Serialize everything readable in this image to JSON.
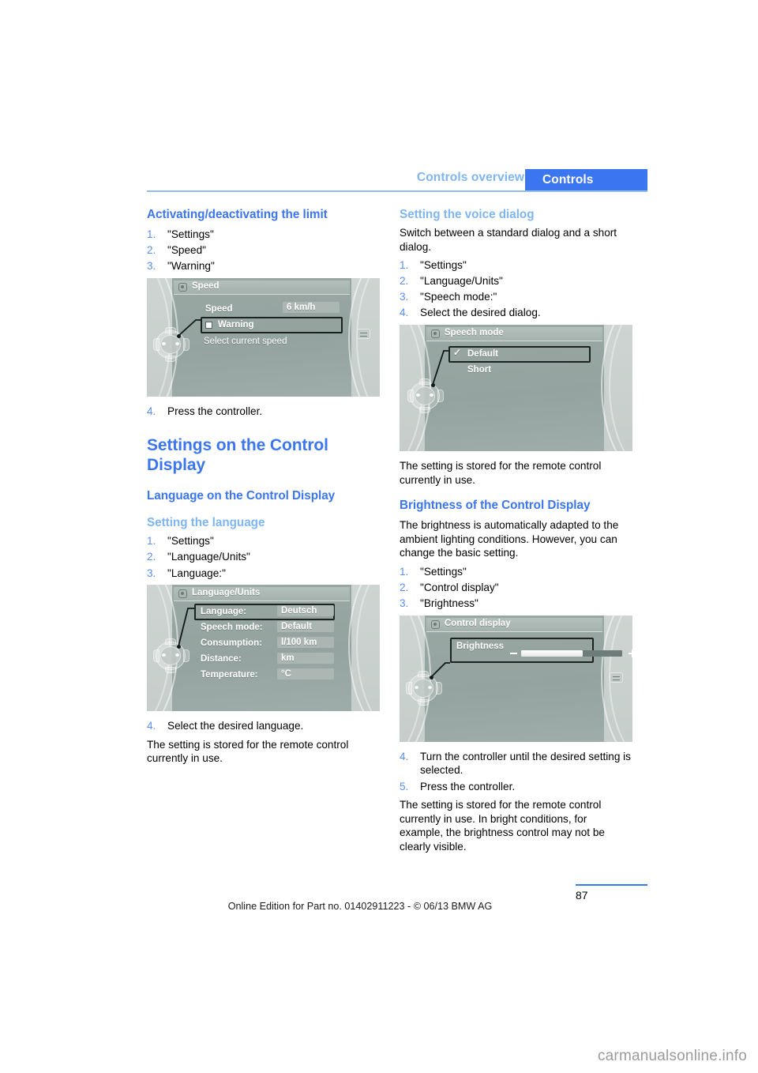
{
  "header": {
    "chapter": "Controls overview",
    "tab": "Controls"
  },
  "left_column": {
    "heading_limit": "Activating/deactivating the limit",
    "limit_steps": [
      "\"Settings\"",
      "\"Speed\"",
      "\"Warning\""
    ],
    "speed_screen": {
      "title": "Speed",
      "row_label": "Speed",
      "row_value": "6 km/h",
      "checkbox_label": "Warning",
      "hint": "Select current speed"
    },
    "step4": "Press the controller.",
    "heading_settings": "Settings on the Control Display",
    "heading_language": "Language on the Control Display",
    "subheading_setting_language": "Setting the language",
    "language_steps": [
      "\"Settings\"",
      "\"Language/Units\"",
      "\"Language:\""
    ],
    "language_screen": {
      "title": "Language/Units",
      "rows": [
        {
          "label": "Language:",
          "value": "Deutsch"
        },
        {
          "label": "Speech mode:",
          "value": "Default"
        },
        {
          "label": "Consumption:",
          "value": "l/100 km"
        },
        {
          "label": "Distance:",
          "value": "km"
        },
        {
          "label": "Temperature:",
          "value": "°C"
        }
      ]
    },
    "step4_language": "Select the desired language.",
    "closing_text": "The setting is stored for the remote control currently in use."
  },
  "right_column": {
    "subheading_voice": "Setting the voice dialog",
    "voice_intro": "Switch between a standard dialog and a short dialog.",
    "voice_steps": [
      "\"Settings\"",
      "\"Language/Units\"",
      "\"Speech mode:\"",
      "Select the desired dialog."
    ],
    "speech_screen": {
      "title": "Speech mode",
      "option_selected": "Default",
      "option_second": "Short"
    },
    "voice_closing": "The setting is stored for the remote control currently in use.",
    "heading_brightness": "Brightness of the Control Display",
    "brightness_intro": "The brightness is automatically adapted to the ambient lighting conditions. However, you can change the basic setting.",
    "brightness_steps": [
      "\"Settings\"",
      "\"Control display\"",
      "\"Brightness\""
    ],
    "brightness_screen": {
      "title": "Control display",
      "row_label": "Brightness",
      "minus": "–",
      "plus": "+"
    },
    "brightness_steps_2": [
      "Turn the controller until the desired setting is selected.",
      "Press the controller."
    ],
    "brightness_closing": "The setting is stored for the remote control currently in use. In bright conditions, for example, the brightness control may not be clearly visible."
  },
  "footer": {
    "page_number": "87",
    "note": "Online Edition for Part no. 01402911223 - © 06/13 BMW AG",
    "watermark": "carmanualsonline.info"
  },
  "colors": {
    "accent_blue": "#3b76f0",
    "light_blue": "#7fb6f2",
    "step_blue": "#5b8ef2"
  }
}
